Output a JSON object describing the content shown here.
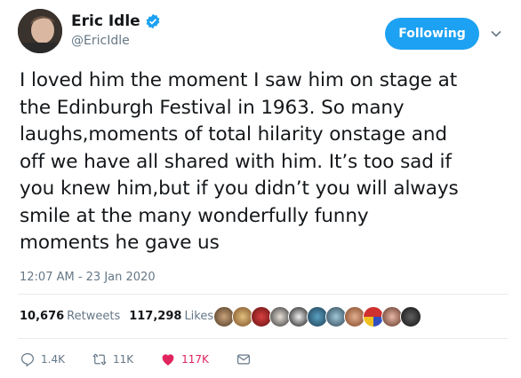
{
  "user": {
    "display_name": "Eric Idle",
    "handle": "@EricIdle",
    "verified_icon": "verified-badge-icon"
  },
  "follow_button": {
    "label": "Following"
  },
  "tweet": {
    "text": "I loved him the moment I saw him on stage at\nthe Edinburgh Festival in 1963. So many\nlaughs,moments of total hilarity onstage and\noff we have all shared with him. It’s too sad if\nyou knew him,but if you didn’t you will always\nsmile at the many wonderfully funny\nmoments he gave us",
    "timestamp": "12:07 AM - 23 Jan 2020"
  },
  "stats": {
    "retweets_count": "10,676",
    "retweets_label": "Retweets",
    "likes_count": "117,298",
    "likes_label": "Likes"
  },
  "actions": {
    "replies": "1.4K",
    "retweets": "11K",
    "likes": "117K"
  },
  "colors": {
    "accent": "#1da1f2",
    "like": "#e0245e",
    "muted": "#657786"
  }
}
